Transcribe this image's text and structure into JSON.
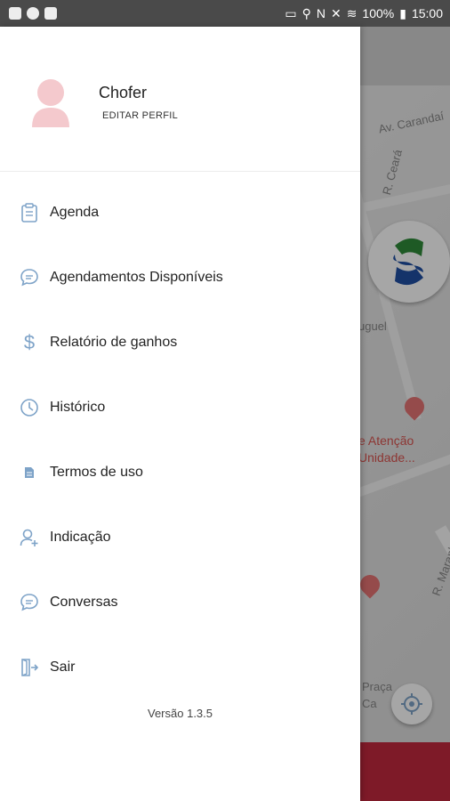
{
  "status_bar": {
    "battery": "100%",
    "time": "15:00"
  },
  "profile": {
    "name": "Chofer",
    "edit_label": "EDITAR PERFIL"
  },
  "menu": {
    "items": [
      {
        "label": "Agenda",
        "icon": "clipboard-icon"
      },
      {
        "label": "Agendamentos Disponíveis",
        "icon": "chat-bubble-icon"
      },
      {
        "label": "Relatório de ganhos",
        "icon": "dollar-icon"
      },
      {
        "label": "Histórico",
        "icon": "clock-icon"
      },
      {
        "label": "Termos de uso",
        "icon": "document-icon"
      },
      {
        "label": "Indicação",
        "icon": "add-user-icon"
      },
      {
        "label": "Conversas",
        "icon": "chat-bubble-icon"
      },
      {
        "label": "Sair",
        "icon": "logout-icon"
      }
    ]
  },
  "version": "Versão 1.3.5",
  "map": {
    "street_1": "Av. Carandaí",
    "street_2": "R. Ceará",
    "label_1": "uguel",
    "poi_label": "e Atenção\nUnidade...",
    "street_3": "R. Maranhão",
    "label_2": "Praça\nCa"
  },
  "colors": {
    "accent": "#7ea3c8",
    "map_bottom": "#c2283e",
    "status_bar": "#4a4a4a"
  }
}
